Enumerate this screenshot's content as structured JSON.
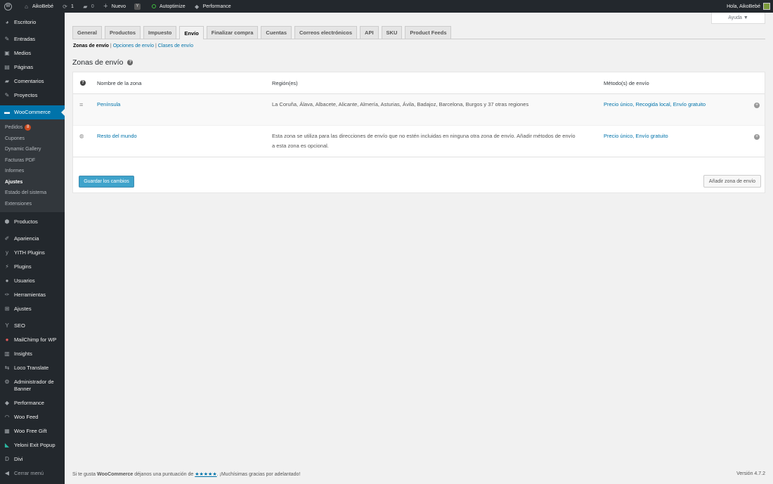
{
  "adminbar": {
    "site_name": "AikoBebé",
    "updates_count": "1",
    "comments_count": "0",
    "new_label": "Nuevo",
    "autoptimize_label": "Autoptimize",
    "performance_label": "Performance",
    "greeting": "Hola, AikoBebé"
  },
  "sidebar": {
    "escritorio": "Escritorio",
    "entradas": "Entradas",
    "medios": "Medios",
    "paginas": "Páginas",
    "comentarios": "Comentarios",
    "proyectos": "Proyectos",
    "woocommerce": "WooCommerce",
    "sub": {
      "pedidos": "Pedidos",
      "pedidos_badge": "8",
      "cupones": "Cupones",
      "dynamic_gallery": "Dynamic Gallery",
      "facturas": "Facturas PDF",
      "informes": "Informes",
      "ajustes": "Ajustes",
      "estado": "Estado del sistema",
      "extensiones": "Extensiones"
    },
    "productos": "Productos",
    "apariencia": "Apariencia",
    "yith": "YITH Plugins",
    "plugins": "Plugins",
    "usuarios": "Usuarios",
    "herramientas": "Herramientas",
    "ajustes": "Ajustes",
    "seo": "SEO",
    "mailchimp": "MailChimp for WP",
    "insights": "Insights",
    "loco": "Loco Translate",
    "banner": "Administrador de Banner",
    "performance": "Performance",
    "woofeed": "Woo Feed",
    "woofree": "Woo Free Gift",
    "yeloni": "Yeloni Exit Popup",
    "divi": "Divi",
    "cerrar": "Cerrar menú"
  },
  "help_label": "Ayuda ▼",
  "tabs": [
    "General",
    "Productos",
    "Impuesto",
    "Envío",
    "Finalizar compra",
    "Cuentas",
    "Correos electrónicos",
    "API",
    "SKU",
    "Product Feeds"
  ],
  "subnav": {
    "zonas": "Zonas de envío",
    "opciones": "Opciones de envío",
    "clases": "Clases de envío"
  },
  "page_title": "Zonas de envío",
  "table": {
    "col_name": "Nombre de la zona",
    "col_region": "Región(es)",
    "col_method": "Método(s) de envío",
    "rows": [
      {
        "name": "Península",
        "region": "La Coruña, Álava, Albacete, Alicante, Almería, Asturias, Ávila, Badajoz, Barcelona, Burgos y 37 otras regiones",
        "region2": "",
        "methods": "Precio único, Recogida local, Envío gratuito"
      },
      {
        "name": "Resto del mundo",
        "region": "Esta zona se utiliza para las direcciones de envío que no estén incluidas en ninguna otra zona de envío. Añadir métodos de envío",
        "region2": "a esta zona es opcional.",
        "methods": "Precio único, Envío gratuito"
      }
    ]
  },
  "buttons": {
    "save": "Guardar los cambios",
    "add_zone": "Añadir zona de envío"
  },
  "footer": {
    "text_before": "Si te gusta",
    "brand": "WooCommerce",
    "text_mid": "déjanos una puntuación de",
    "stars": "★★★★★",
    "text_after": ". ¡Muchísimas gracias por adelantado!",
    "version": "Versión 4.7.2"
  },
  "colors": {
    "admin_dark": "#23282d",
    "accent": "#0073aa",
    "button_primary": "#0085ba"
  }
}
